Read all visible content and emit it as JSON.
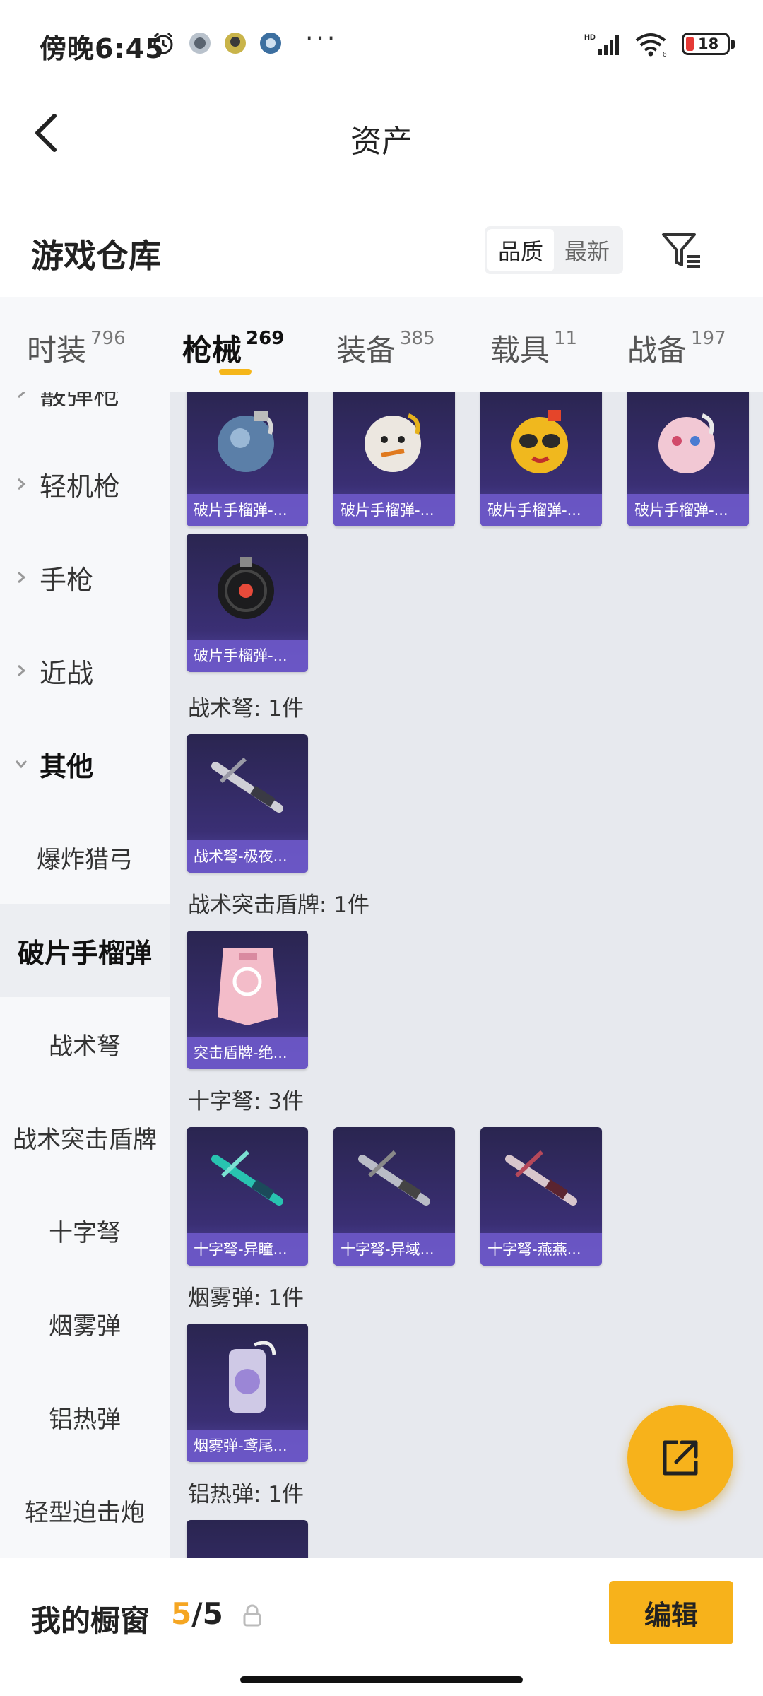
{
  "status_bar": {
    "time": "傍晚6:45",
    "dots": "···",
    "battery": "18"
  },
  "header": {
    "title": "资产"
  },
  "warehouse": {
    "title": "游戏仓库",
    "sort_options": [
      "品质",
      "最新"
    ]
  },
  "tabs": [
    {
      "label": "时装",
      "count": "796"
    },
    {
      "label": "枪械",
      "count": "269"
    },
    {
      "label": "装备",
      "count": "385"
    },
    {
      "label": "载具",
      "count": "11"
    },
    {
      "label": "战备",
      "count": "197"
    }
  ],
  "sidebar": {
    "partial_top": "霰弹枪",
    "categories": [
      "轻机枪",
      "手枪",
      "近战",
      "其他"
    ],
    "subitems": [
      "爆炸猎弓",
      "破片手榴弹",
      "战术弩",
      "战术突击盾牌",
      "十字弩",
      "烟雾弹",
      "铝热弹",
      "轻型迫击炮"
    ]
  },
  "content": {
    "grenade_cards": [
      "破片手榴弹-...",
      "破片手榴弹-...",
      "破片手榴弹-...",
      "破片手榴弹-...",
      "破片手榴弹-..."
    ],
    "sections": [
      {
        "label": "战术弩: 1件",
        "cards": [
          "战术弩-极夜..."
        ]
      },
      {
        "label": "战术突击盾牌: 1件",
        "cards": [
          "突击盾牌-绝..."
        ]
      },
      {
        "label": "十字弩: 3件",
        "cards": [
          "十字弩-异瞳...",
          "十字弩-异域...",
          "十字弩-燕燕..."
        ]
      },
      {
        "label": "烟雾弹: 1件",
        "cards": [
          "烟雾弹-鸢尾..."
        ]
      },
      {
        "label": "铝热弹: 1件",
        "cards": []
      }
    ]
  },
  "bottom_bar": {
    "label": "我的橱窗",
    "current": "5",
    "separator": "/",
    "max": "5",
    "edit_label": "编辑"
  },
  "colors": {
    "accent": "#f7b21b",
    "card_bg": "#3a2f74",
    "card_caption": "#6c58c8"
  }
}
